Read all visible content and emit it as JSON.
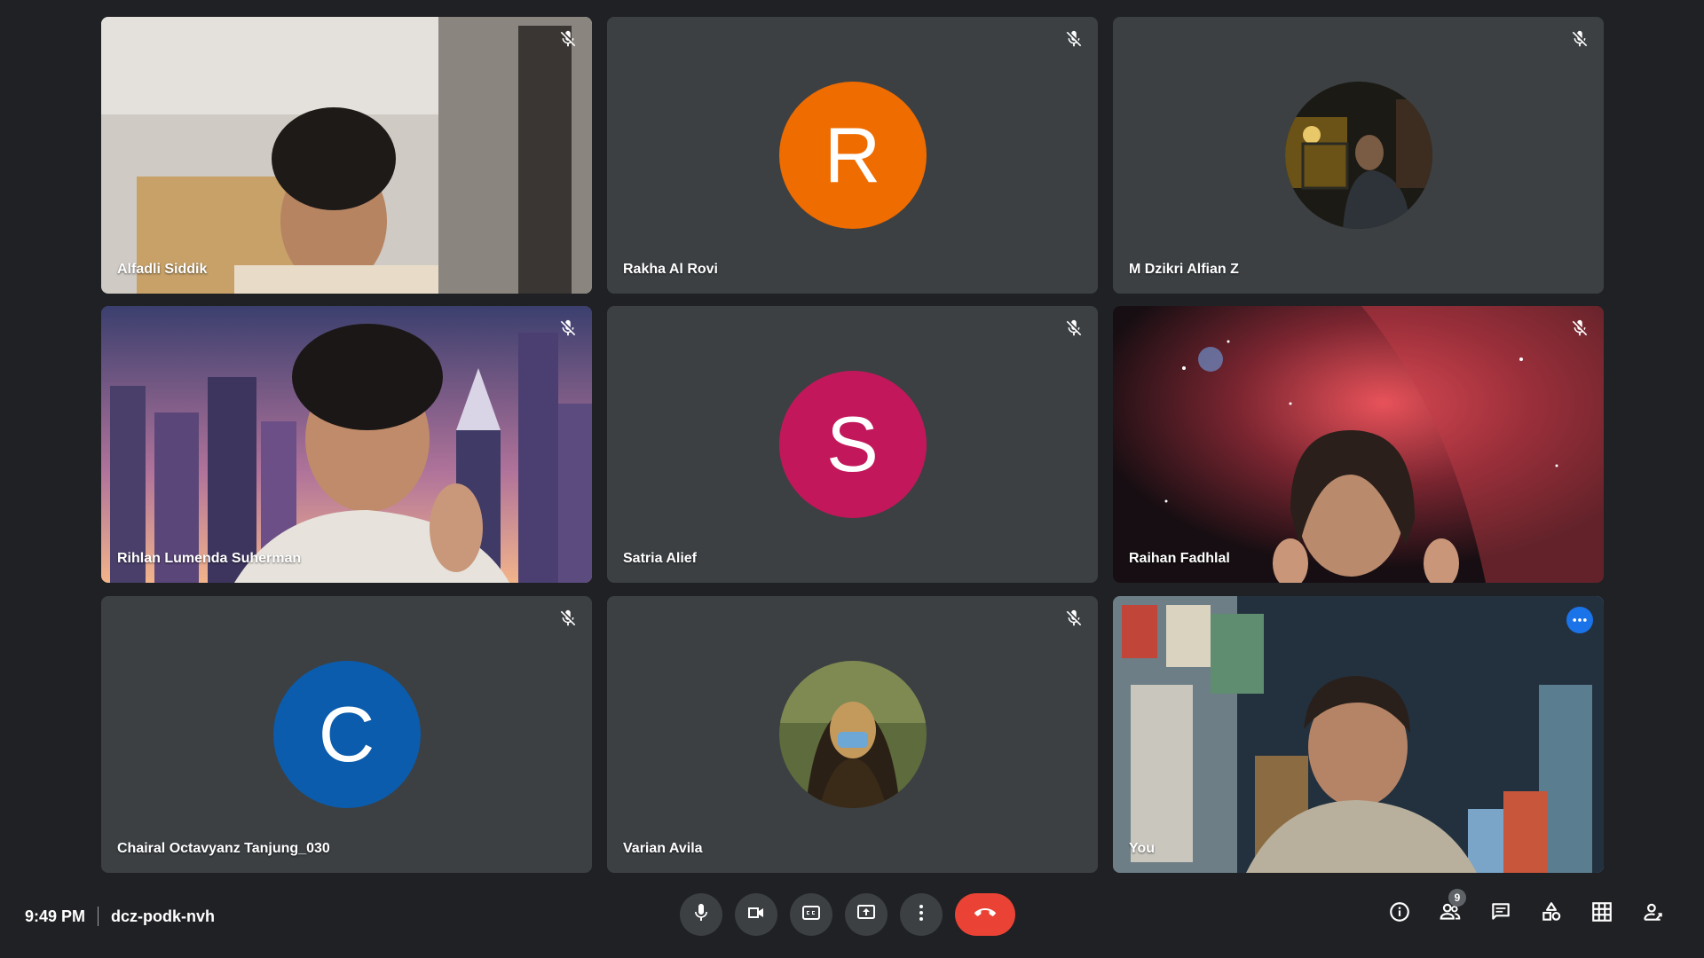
{
  "participants": [
    {
      "name": "Alfadli Siddik",
      "muted": true,
      "type": "video"
    },
    {
      "name": "Rakha Al Rovi",
      "muted": true,
      "type": "initial",
      "initial": "R",
      "color": "#ef6c00"
    },
    {
      "name": "M Dzikri Alfian Z",
      "muted": true,
      "type": "photo"
    },
    {
      "name": "Rihlan Lumenda Suherman",
      "muted": true,
      "type": "video"
    },
    {
      "name": "Satria Alief",
      "muted": true,
      "type": "initial",
      "initial": "S",
      "color": "#c2185b"
    },
    {
      "name": "Raihan Fadhlal",
      "muted": true,
      "type": "video"
    },
    {
      "name": "Chairal Octavyanz Tanjung_030",
      "muted": true,
      "type": "initial",
      "initial": "C",
      "color": "#0b5cad"
    },
    {
      "name": "Varian Avila",
      "muted": true,
      "type": "photo"
    },
    {
      "name": "You",
      "muted": false,
      "type": "video",
      "self": true
    }
  ],
  "meeting": {
    "time": "9:49 PM",
    "code": "dcz-podk-nvh"
  },
  "people_count": "9",
  "colors": {
    "background": "#202124",
    "tile": "#3c4043",
    "end_call": "#ea4335",
    "self_outline": "#8ab4f8"
  },
  "icons": {
    "mute": "mic-off-icon",
    "mic": "mic-icon",
    "camera": "videocam-icon",
    "captions": "closed-caption-icon",
    "present": "present-screen-icon",
    "more": "more-vert-icon",
    "end": "call-end-icon",
    "info": "info-icon",
    "people": "people-icon",
    "chat": "chat-icon",
    "activities": "activities-icon",
    "layout": "grid-layout-icon",
    "host": "host-controls-icon"
  }
}
